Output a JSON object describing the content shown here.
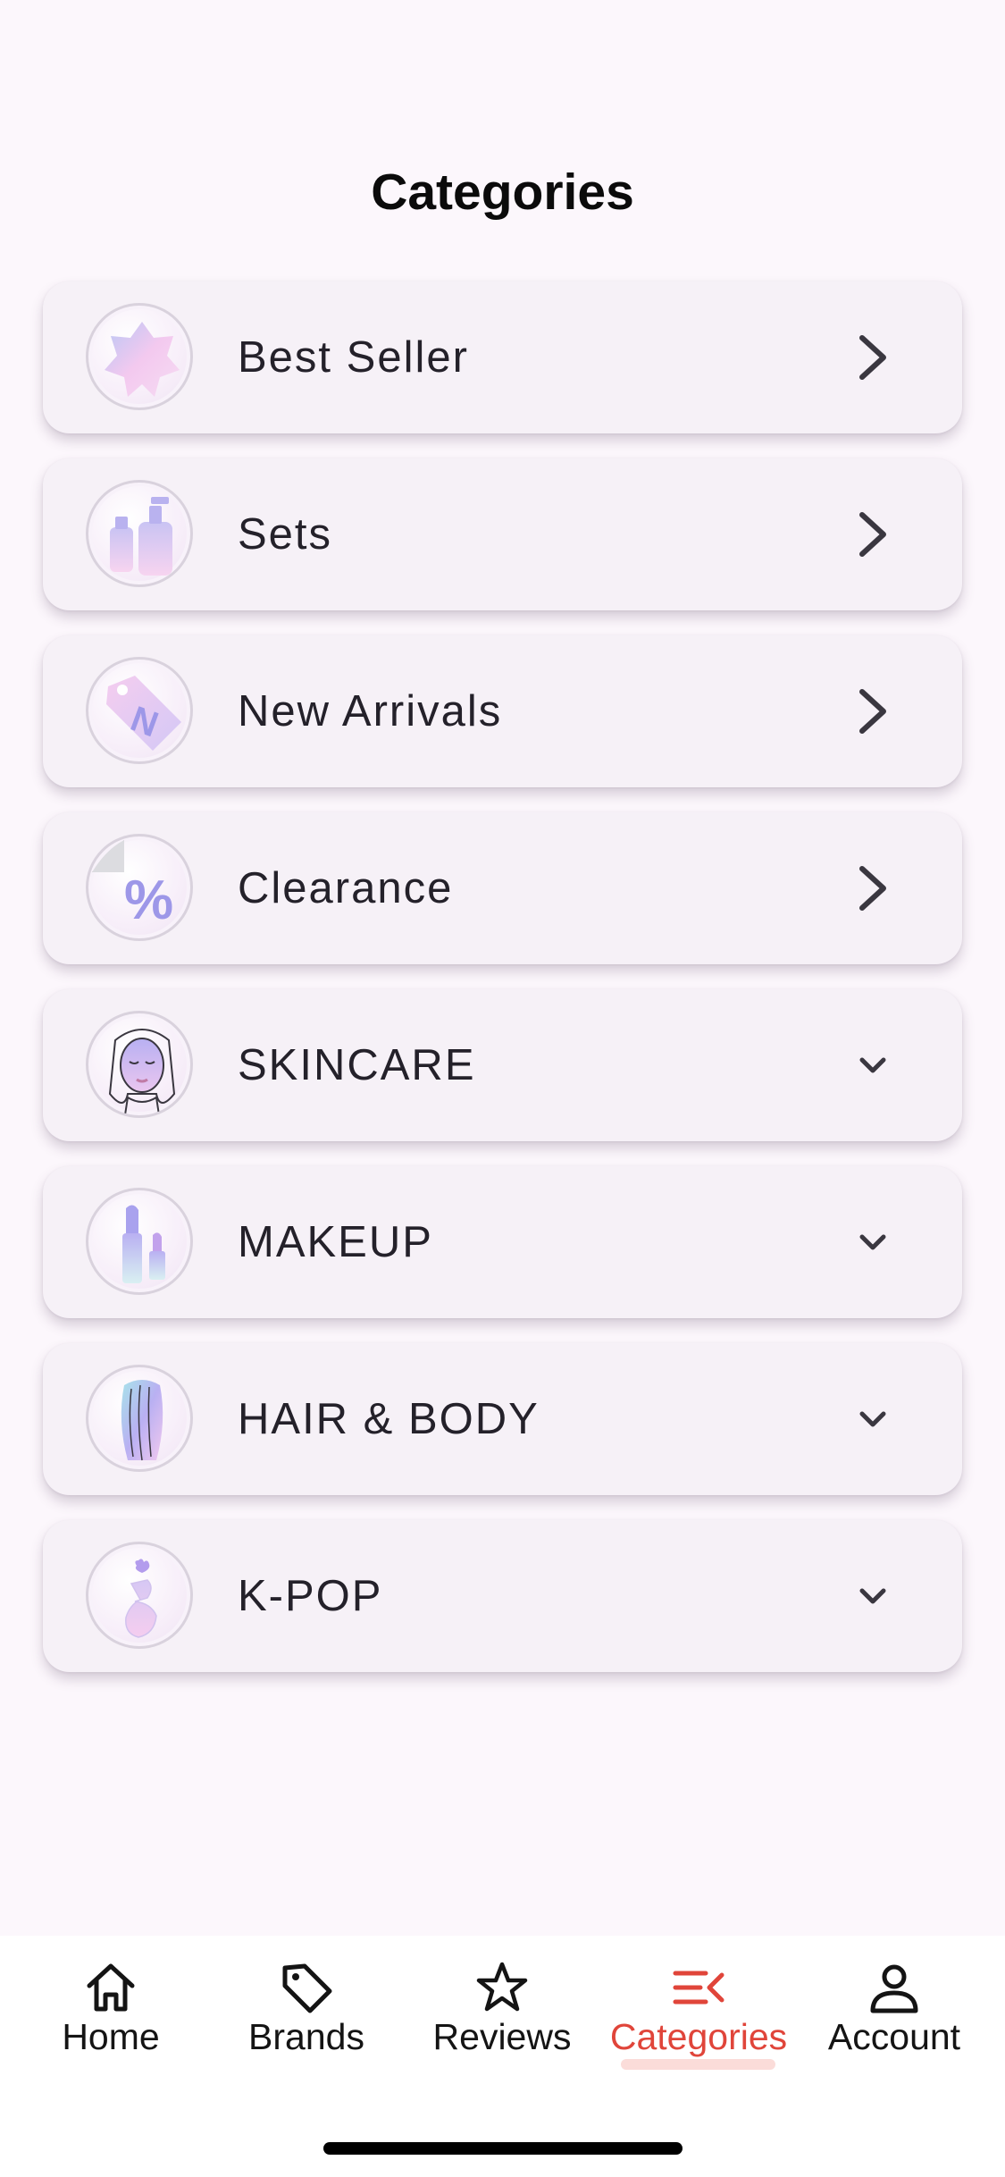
{
  "header": {
    "title": "Categories"
  },
  "categories": [
    {
      "label": "Best Seller",
      "icon": "star-badge-icon",
      "chevron": "chevron-right-icon"
    },
    {
      "label": "Sets",
      "icon": "bottles-set-icon",
      "chevron": "chevron-right-icon"
    },
    {
      "label": "New Arrivals",
      "icon": "new-tag-icon",
      "chevron": "chevron-right-icon"
    },
    {
      "label": "Clearance",
      "icon": "percent-sticker-icon",
      "chevron": "chevron-right-icon"
    },
    {
      "label": "SKINCARE",
      "icon": "face-icon",
      "chevron": "chevron-down-icon"
    },
    {
      "label": "MAKEUP",
      "icon": "lipstick-icon",
      "chevron": "chevron-down-icon"
    },
    {
      "label": "HAIR & BODY",
      "icon": "hair-icon",
      "chevron": "chevron-down-icon"
    },
    {
      "label": "K-POP",
      "icon": "finger-heart-icon",
      "chevron": "chevron-down-icon"
    }
  ],
  "tabbar": {
    "items": [
      {
        "label": "Home",
        "icon": "home-icon",
        "active": false
      },
      {
        "label": "Brands",
        "icon": "tag-icon",
        "active": false
      },
      {
        "label": "Reviews",
        "icon": "star-outline-icon",
        "active": false
      },
      {
        "label": "Categories",
        "icon": "categories-menu-icon",
        "active": true
      },
      {
        "label": "Account",
        "icon": "person-icon",
        "active": false
      }
    ]
  },
  "colors": {
    "background": "#fcf7fc",
    "card": "#f6f1f7",
    "accent": "#e0453a",
    "accent_soft": "#fbdcd9",
    "text": "#24212a"
  }
}
